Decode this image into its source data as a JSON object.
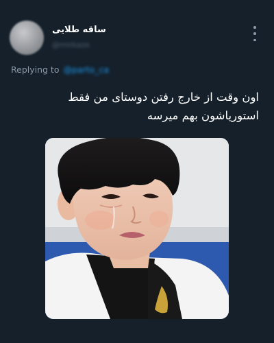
{
  "author": {
    "display_name": "ساقه طلایی",
    "handle": "@mirkaze"
  },
  "menu": {
    "icon": "more-vertical-icon"
  },
  "reply": {
    "prefix": "Replying to",
    "target_handle": "@parto_ca"
  },
  "tweet": {
    "lines": [
      "اون وقت از خارج رفتن دوستای من فقط",
      "استوریاشون بهم میرسه"
    ]
  },
  "media": {
    "alt": "",
    "kind": "photo"
  },
  "colors": {
    "background": "#15202b",
    "text": "#e7e9ea",
    "muted": "#8b98a5",
    "accent": "#1d9bf0"
  }
}
